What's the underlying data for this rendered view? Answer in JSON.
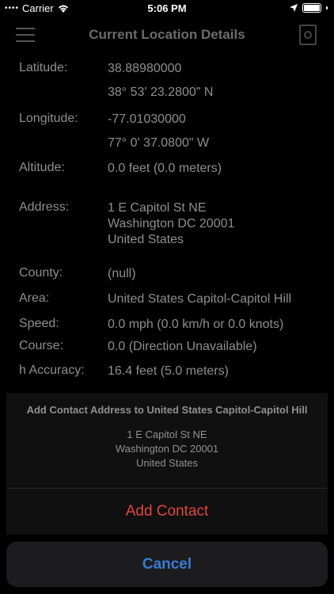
{
  "status_bar": {
    "carrier": "Carrier",
    "time": "5:06 PM"
  },
  "nav": {
    "title": "Current Location Details"
  },
  "details": [
    {
      "label": "Latitude:",
      "lines": [
        "38.88980000",
        "",
        "38° 53' 23.2800\" N"
      ]
    },
    {
      "label": "Longitude:",
      "lines": [
        "-77.01030000",
        "",
        "77° 0' 37.0800\" W"
      ]
    },
    {
      "label": "Altitude:",
      "lines": [
        "0.0 feet (0.0 meters)"
      ]
    },
    {
      "label": "Address:",
      "lines": [
        "1 E Capitol St NE",
        "Washington DC 20001",
        "United States"
      ]
    },
    {
      "label": "County:",
      "lines": [
        "(null)"
      ]
    },
    {
      "label": "Area:",
      "lines": [
        "United States Capitol-Capitol Hill"
      ]
    },
    {
      "label": "Speed:",
      "lines": [
        "0.0 mph (0.0 km/h or 0.0 knots)"
      ]
    },
    {
      "label": "Course:",
      "lines": [
        "0.0 (Direction Unavailable)"
      ]
    },
    {
      "label": "h Accuracy:",
      "lines": [
        "16.4 feet (5.0 meters)"
      ]
    }
  ],
  "action_sheet": {
    "title": "Add Contact Address to United States Capitol-Capitol Hill",
    "message": [
      "1 E Capitol St NE",
      "Washington DC 20001",
      "United States"
    ],
    "add_contact_label": "Add Contact",
    "cancel_label": "Cancel"
  }
}
